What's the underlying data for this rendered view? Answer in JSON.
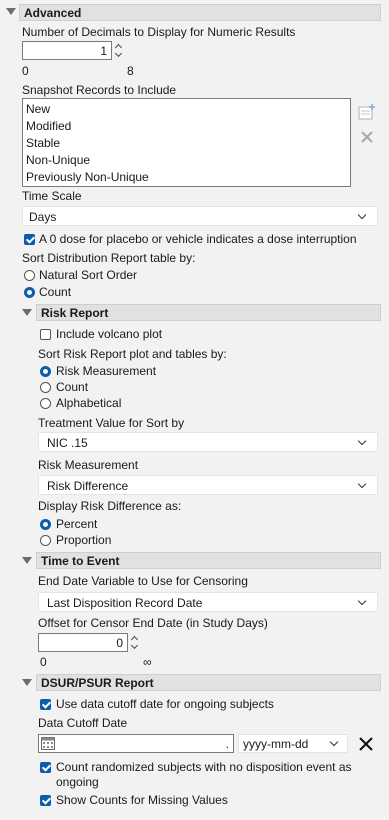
{
  "advanced": {
    "title": "Advanced",
    "decimals_label": "Number of Decimals to Display for Numeric Results",
    "decimals_value": "1",
    "decimals_min": "0",
    "decimals_max": "8",
    "snapshot_label": "Snapshot Records to Include",
    "snapshot_items": [
      "New",
      "Modified",
      "Stable",
      "Non-Unique",
      "Previously Non-Unique"
    ],
    "time_scale_label": "Time Scale",
    "time_scale_value": "Days",
    "dose_interrupt_label": "A 0 dose for placebo or vehicle indicates a dose interruption",
    "sort_dist_label": "Sort Distribution Report table by:",
    "sort_dist_options": [
      "Natural Sort Order",
      "Count"
    ],
    "sort_dist_selected": "Count"
  },
  "risk_report": {
    "title": "Risk Report",
    "volcano_label": "Include volcano plot",
    "sort_label": "Sort Risk Report plot and tables by:",
    "sort_options": [
      "Risk Measurement",
      "Count",
      "Alphabetical"
    ],
    "sort_selected": "Risk Measurement",
    "treatment_label": "Treatment Value for Sort by",
    "treatment_value": "NIC .15",
    "measurement_label": "Risk Measurement",
    "measurement_value": "Risk Difference",
    "display_label": "Display Risk Difference as:",
    "display_options": [
      "Percent",
      "Proportion"
    ],
    "display_selected": "Percent"
  },
  "time_to_event": {
    "title": "Time to Event",
    "end_date_label": "End Date Variable to Use for Censoring",
    "end_date_value": "Last Disposition Record Date",
    "offset_label": "Offset for Censor End Date (in Study Days)",
    "offset_value": "0",
    "offset_min": "0",
    "offset_max": "∞"
  },
  "dsur": {
    "title": "DSUR/PSUR Report",
    "use_cutoff_label": "Use data cutoff date for ongoing subjects",
    "cutoff_label": "Data Cutoff Date",
    "cutoff_value": ".",
    "date_format": "yyyy-mm-dd",
    "count_randomized_label_line1": "Count randomized subjects with no disposition event as",
    "count_randomized_label_line2": "ongoing",
    "show_missing_label": "Show Counts for Missing Values"
  },
  "colors": {
    "accent": "#0b5cad",
    "header_bg": "#e1e1e1",
    "panel_bg": "#f2f2f2"
  }
}
